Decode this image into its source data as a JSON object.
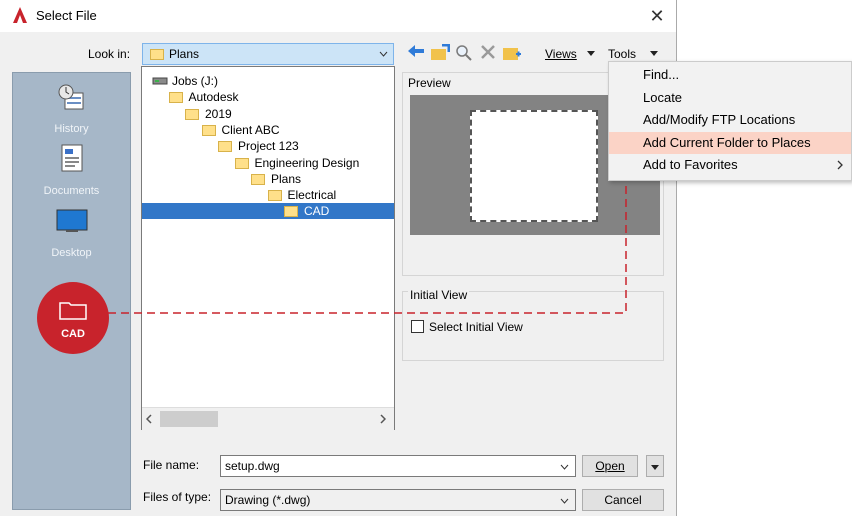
{
  "dialog": {
    "title": "Select File",
    "close_glyph": "✕"
  },
  "look_in": {
    "label": "Look in:",
    "value": "Plans"
  },
  "toolbar": {
    "views_label": "Views",
    "tools_label": "Tools",
    "icons": [
      "back-arrow-icon",
      "up-folder-icon",
      "search-web-icon",
      "delete-icon",
      "create-folder-icon"
    ]
  },
  "places": {
    "items": [
      {
        "label": "History",
        "icon": "history-icon"
      },
      {
        "label": "Documents",
        "icon": "documents-icon"
      },
      {
        "label": "Desktop",
        "icon": "desktop-icon"
      }
    ]
  },
  "tree": {
    "nodes": [
      {
        "label": "Jobs (J:)",
        "level": 0,
        "icon": "drive-icon"
      },
      {
        "label": "Autodesk",
        "level": 1
      },
      {
        "label": "2019",
        "level": 2
      },
      {
        "label": "Client ABC",
        "level": 3
      },
      {
        "label": "Project 123",
        "level": 4
      },
      {
        "label": "Engineering Design",
        "level": 5
      },
      {
        "label": "Plans",
        "level": 6
      },
      {
        "label": "Electrical",
        "level": 7
      },
      {
        "label": "CAD",
        "level": 8,
        "selected": true
      }
    ]
  },
  "preview": {
    "label": "Preview"
  },
  "initial_view": {
    "group_label": "Initial View",
    "checkbox_label": "Select Initial View",
    "checked": false
  },
  "file_name": {
    "label": "File name:",
    "value": "setup.dwg"
  },
  "files_of_type": {
    "label": "Files of type:",
    "value": "Drawing (*.dwg)"
  },
  "buttons": {
    "open": "Open",
    "cancel": "Cancel"
  },
  "tools_menu": {
    "items": [
      {
        "label": "Find...",
        "highlighted": false
      },
      {
        "label": "Locate",
        "highlighted": false
      },
      {
        "label": "Add/Modify FTP Locations",
        "highlighted": false
      },
      {
        "label": "Add Current Folder to Places",
        "highlighted": true
      },
      {
        "label": "Add to Favorites",
        "highlighted": false,
        "submenu": true
      }
    ]
  },
  "new_place": {
    "label": "CAD"
  },
  "colors": {
    "accent_red": "#c8232c",
    "selection_blue": "#3277c8",
    "menu_highlight": "#fbd3c6",
    "places_bg": "#a6b7c8"
  }
}
